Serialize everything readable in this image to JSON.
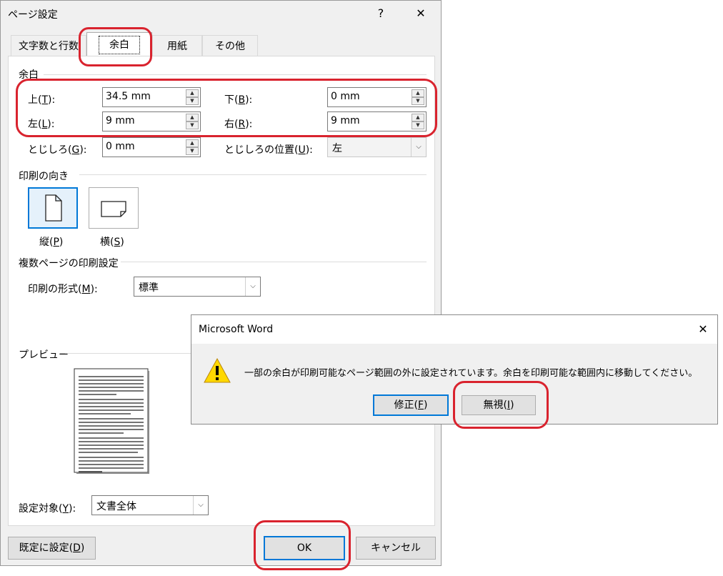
{
  "page_setup": {
    "title": "ページ設定",
    "help": "?",
    "close": "✕",
    "tabs": [
      {
        "label": "文字数と行数"
      },
      {
        "label": "余白"
      },
      {
        "label": "用紙"
      },
      {
        "label": "その他"
      }
    ],
    "margins": {
      "title": "余白",
      "top": {
        "label": "上(",
        "key": "T",
        "tail": "):",
        "value": "34.5 mm"
      },
      "bottom": {
        "label": "下(",
        "key": "B",
        "tail": "):",
        "value": "0 mm"
      },
      "left": {
        "label": "左(",
        "key": "L",
        "tail": "):",
        "value": "9 mm"
      },
      "right": {
        "label": "右(",
        "key": "R",
        "tail": "):",
        "value": "9 mm"
      },
      "gutter": {
        "label": "とじしろ(",
        "key": "G",
        "tail": "):",
        "value": "0 mm"
      },
      "gutter_pos": {
        "label": "とじしろの位置(",
        "key": "U",
        "tail": "):",
        "value": "左"
      }
    },
    "orientation": {
      "title": "印刷の向き",
      "portrait": {
        "label": "縦(",
        "key": "P",
        "tail": ")"
      },
      "landscape": {
        "label": "横(",
        "key": "S",
        "tail": ")"
      }
    },
    "multi_page": {
      "title": "複数ページの印刷設定",
      "label": "印刷の形式(",
      "key": "M",
      "tail": "):",
      "value": "標準"
    },
    "preview": {
      "title": "プレビュー"
    },
    "apply_to": {
      "label": "設定対象(",
      "key": "Y",
      "tail": "):",
      "value": "文書全体"
    },
    "buttons": {
      "default": {
        "label": "既定に設定(",
        "key": "D",
        "tail": ")"
      },
      "ok": "OK",
      "cancel": "キャンセル"
    }
  },
  "msgbox": {
    "title": "Microsoft Word",
    "close": "✕",
    "icon": "warning-icon",
    "message": "一部の余白が印刷可能なページ範囲の外に設定されています。余白を印刷可能な範囲内に移動してください。",
    "fix": {
      "label": "修正(",
      "key": "F",
      "tail": ")"
    },
    "ignore": {
      "label": "無視(",
      "key": "I",
      "tail": ")"
    }
  },
  "colors": {
    "accent": "#0078d7",
    "highlight": "#d9232e",
    "warning": "#ffd800"
  }
}
